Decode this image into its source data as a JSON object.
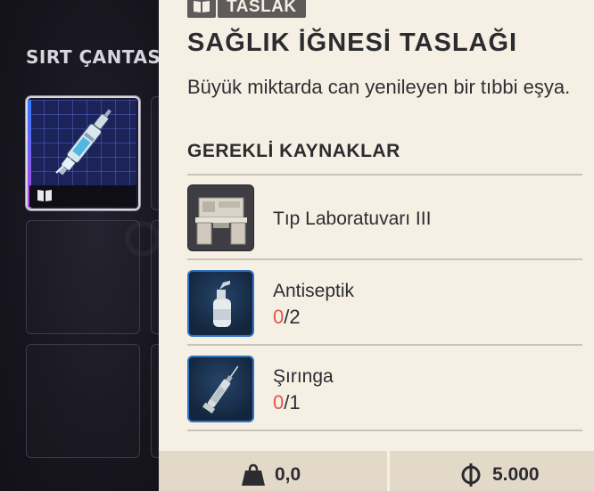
{
  "inventory": {
    "title": "SIRT ÇANTASI"
  },
  "item": {
    "tag_label": "TASLAK",
    "title": "SAĞLIK İĞNESİ TASLAĞI",
    "description": "Büyük miktarda can yenileyen bir tıbbi eşya.",
    "requirements_heading": "GEREKLİ KAYNAKLAR",
    "resources": [
      {
        "name": "Tıp Laboratuvarı III",
        "icon": "medical-lab-icon"
      },
      {
        "name": "Antiseptik",
        "have": "0",
        "need": "/2",
        "icon": "antiseptic-bottle-icon"
      },
      {
        "name": "Şırınga",
        "have": "0",
        "need": "/1",
        "icon": "syringe-icon"
      }
    ]
  },
  "footer": {
    "weight": "0,0",
    "price": "5.000"
  },
  "colors": {
    "panel_bg": "#f6efe4",
    "missing_qty": "#e0574f",
    "rarity_border": "#2f73c4"
  }
}
